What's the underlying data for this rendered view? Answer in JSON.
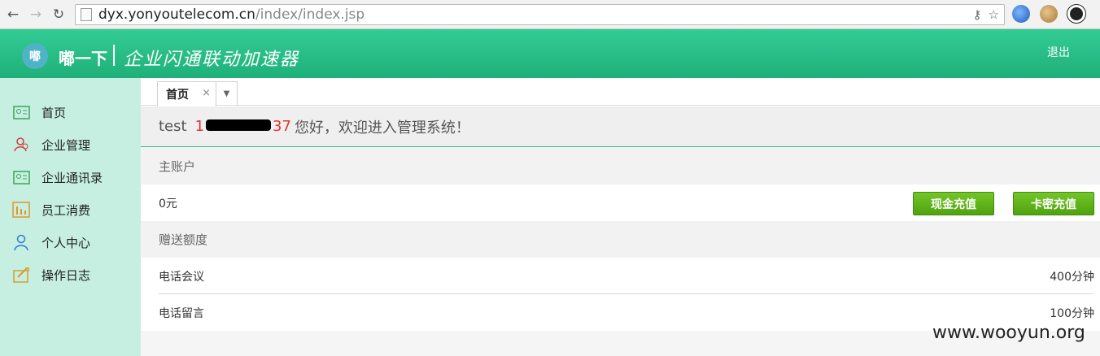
{
  "browser": {
    "url_host": "dyx.yonyoutelecom.cn",
    "url_path": "/index/index.jsp"
  },
  "header": {
    "logo_text": "嘟",
    "title": "嘟一下",
    "subtitle": "企业闪通联动加速器",
    "logout": "退出"
  },
  "sidebar": {
    "items": [
      {
        "label": "首页",
        "icon": "id-card-icon"
      },
      {
        "label": "企业管理",
        "icon": "users-icon"
      },
      {
        "label": "企业通讯录",
        "icon": "contacts-icon"
      },
      {
        "label": "员工消费",
        "icon": "bar-chart-icon"
      },
      {
        "label": "个人中心",
        "icon": "person-icon"
      },
      {
        "label": "操作日志",
        "icon": "log-icon"
      }
    ]
  },
  "tabs": [
    {
      "label": "首页",
      "close": "×",
      "menu": "▼"
    }
  ],
  "welcome": {
    "user": "test",
    "phone_start": "1",
    "phone_end": "37",
    "message": "您好，欢迎进入管理系统！"
  },
  "main_account": {
    "title": "主账户",
    "balance": "0元",
    "cash_button": "现金充值",
    "card_button": "卡密充值"
  },
  "gift_quota": {
    "title": "赠送额度",
    "rows": [
      {
        "label": "电话会议",
        "value": "400分钟"
      },
      {
        "label": "电话留言",
        "value": "100分钟"
      }
    ]
  },
  "watermark": "www.wooyun.org",
  "colors": {
    "header_green": "#2ec38a",
    "sidebar_bg": "#c6efe1",
    "button_green": "#5fb21b",
    "phone_red": "#e53333"
  }
}
